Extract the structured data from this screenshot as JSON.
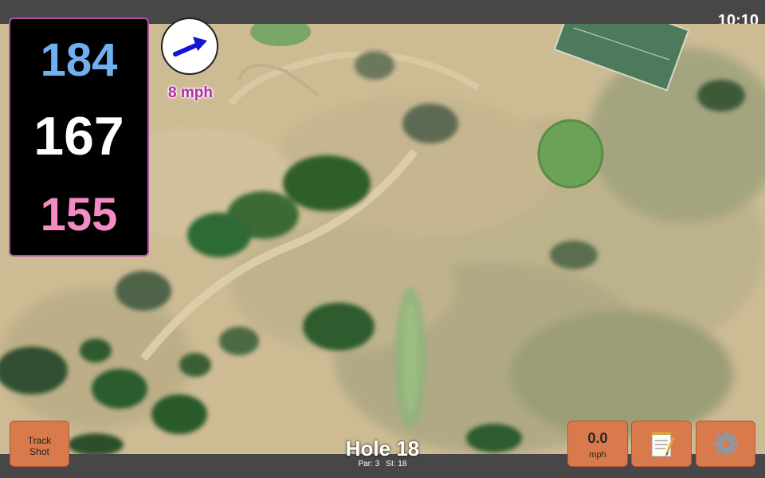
{
  "status": {
    "time": "10:10"
  },
  "distances": {
    "back": "184",
    "middle": "167",
    "front": "155"
  },
  "wind": {
    "speed_label": "8 mph",
    "direction_icon": "arrow-east-northeast",
    "arrow_color": "#1414d4"
  },
  "hole": {
    "title": "Hole 18",
    "par": "Par: 3",
    "si": "SI: 18"
  },
  "buttons": {
    "track_shot_line1": "Track",
    "track_shot_line2": "Shot",
    "speed_value": "0.0",
    "speed_unit": "mph",
    "notes_icon": "notepad-icon",
    "settings_icon": "gear-icon"
  },
  "colors": {
    "back_distance": "#6fb0f0",
    "middle_distance": "#ffffff",
    "front_distance": "#f58ac4",
    "button_bg": "#d87a4c",
    "panel_border": "#b44fa9"
  }
}
